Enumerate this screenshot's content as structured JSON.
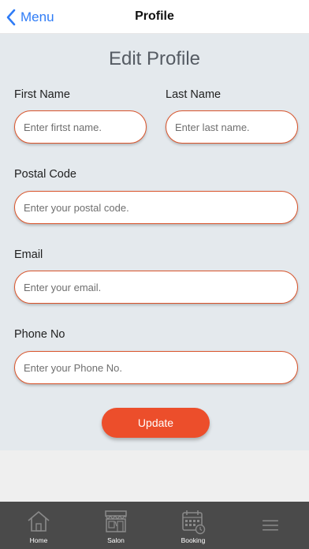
{
  "nav": {
    "back_label": "Menu",
    "title": "Profile"
  },
  "form": {
    "heading": "Edit Profile",
    "first_name": {
      "label": "First Name",
      "placeholder": "Enter firtst name.",
      "value": ""
    },
    "last_name": {
      "label": "Last Name",
      "placeholder": "Enter last name.",
      "value": ""
    },
    "postal_code": {
      "label": "Postal Code",
      "placeholder": "Enter your postal code.",
      "value": ""
    },
    "email": {
      "label": "Email",
      "placeholder": "Enter your email.",
      "value": ""
    },
    "phone": {
      "label": "Phone No",
      "placeholder": "Enter your Phone No.",
      "value": ""
    },
    "submit_label": "Update"
  },
  "tabbar": {
    "items": [
      {
        "label": "Home",
        "icon": "home-icon"
      },
      {
        "label": "Salon",
        "icon": "salon-icon"
      },
      {
        "label": "Booking",
        "icon": "booking-icon"
      },
      {
        "label": "",
        "icon": "menu-icon"
      }
    ]
  },
  "colors": {
    "accent": "#ec4e2b",
    "field_border": "#d9542b",
    "link_blue": "#2f7cf6",
    "content_bg": "#e4e9ed",
    "tabbar_bg": "#4a4a4a"
  }
}
